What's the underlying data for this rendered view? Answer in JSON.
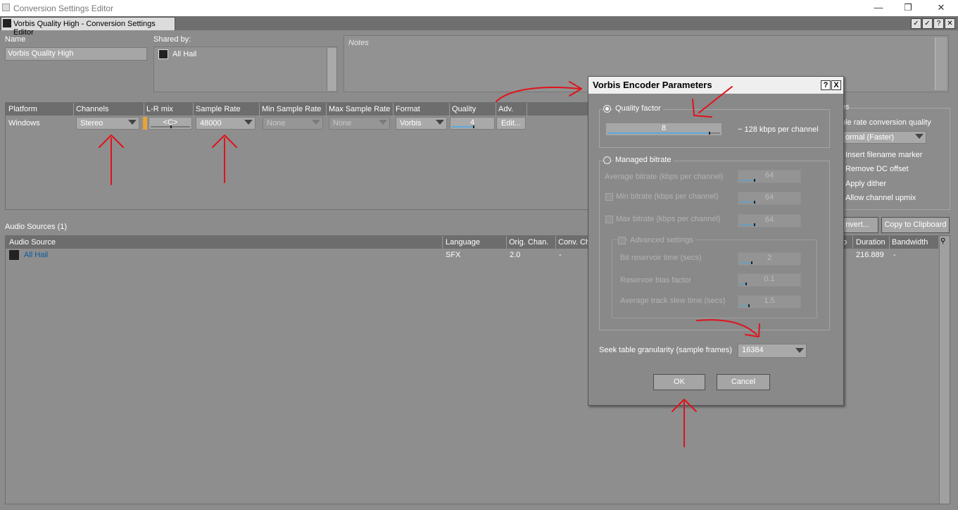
{
  "window": {
    "title": "Conversion Settings Editor"
  },
  "tab": {
    "label": "Vorbis Quality High - Conversion Settings Editor"
  },
  "top": {
    "name_label": "Name",
    "name_value": "Vorbis Quality High",
    "shared_label": "Shared by:",
    "shared_item": "All Hail",
    "notes_placeholder": "Notes"
  },
  "platform_table": {
    "headers": [
      "Platform",
      "Channels",
      "L-R mix",
      "Sample Rate",
      "Min Sample Rate",
      "Max Sample Rate",
      "Format",
      "Quality",
      "Adv."
    ],
    "row": {
      "platform": "Windows",
      "channels": "Stereo",
      "lr_mix": "<C>",
      "sample_rate": "48000",
      "min_sample_rate": "None",
      "max_sample_rate": "None",
      "format": "Vorbis",
      "quality": "4",
      "adv": "Edit..."
    }
  },
  "right_panel": {
    "header_fragment": "ns",
    "sample_rate_quality_label": "ple rate conversion quality",
    "sample_rate_quality_value": "ormal (Faster)",
    "options": [
      "Insert filename marker",
      "Remove DC offset",
      "Apply dither",
      "Allow channel upmix"
    ],
    "convert_button": "nvert...",
    "copy_button": "Copy to Clipboard"
  },
  "audio_sources": {
    "title": "Audio Sources (1)",
    "headers": [
      "Audio Source",
      "Language",
      "Orig. Chan.",
      "Conv. Ch",
      "o",
      "Duration",
      "Bandwidth"
    ],
    "rows": [
      {
        "name": "All Hail",
        "language": "SFX",
        "orig_chan": "2.0",
        "conv_ch": "-",
        "duration": "216.889",
        "bandwidth": "-"
      }
    ]
  },
  "dialog": {
    "title": "Vorbis Encoder Parameters",
    "help_button": "?",
    "close_button": "X",
    "quality_factor_label": "Quality factor",
    "quality_value": "8",
    "quality_fraction": 0.9,
    "kbps_note": "~ 128 kbps per channel",
    "managed_label": "Managed bitrate",
    "avg_bitrate_label": "Average bitrate (kbps per channel)",
    "avg_bitrate_value": "64",
    "min_bitrate_label": "Min bitrate (kbps per channel)",
    "min_bitrate_value": "64",
    "max_bitrate_label": "Max bitrate (kbps per channel)",
    "max_bitrate_value": "64",
    "advanced_label": "Advanced settings",
    "reservoir_time_label": "Bit reservoir time (secs)",
    "reservoir_time_value": "2",
    "reservoir_bias_label": "Reservoir bias factor",
    "reservoir_bias_value": "0.1",
    "slew_label": "Average track slew time (secs)",
    "slew_value": "1.5",
    "seek_label": "Seek table granularity (sample frames)",
    "seek_value": "16384",
    "ok_button": "OK",
    "cancel_button": "Cancel"
  },
  "colors": {
    "annotation": "#e0131b",
    "link": "#0a5b9c",
    "slider_fill": "#5aa9d9"
  }
}
